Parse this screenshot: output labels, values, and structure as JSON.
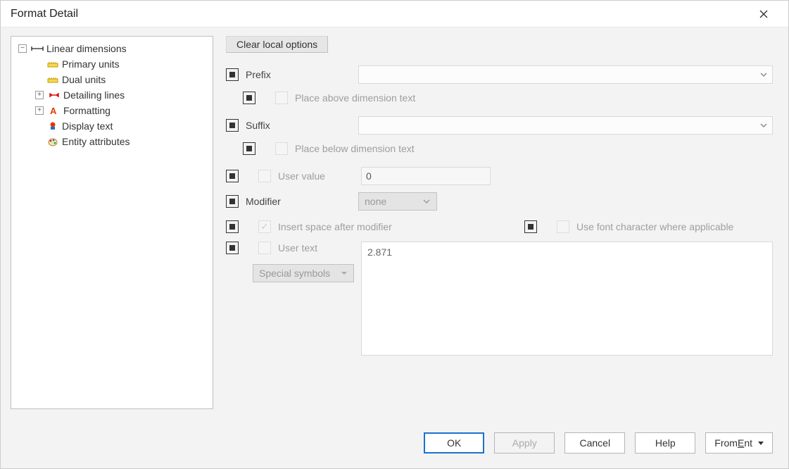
{
  "title": "Format Detail",
  "tree": {
    "root": "Linear dimensions",
    "primary": "Primary units",
    "dual": "Dual units",
    "detailing": "Detailing lines",
    "formatting": "Formatting",
    "display": "Display text",
    "entity": "Entity attributes"
  },
  "form": {
    "clear": "Clear local options",
    "prefix_label": "Prefix",
    "prefix_above": "Place above dimension text",
    "suffix_label": "Suffix",
    "suffix_below": "Place below dimension text",
    "user_value_label": "User value",
    "user_value": "0",
    "modifier_label": "Modifier",
    "modifier_value": "none",
    "insert_space": "Insert space after modifier",
    "use_font_char": "Use font character where applicable",
    "user_text_label": "User text",
    "user_text_value": "2.871",
    "special_symbols": "Special symbols"
  },
  "buttons": {
    "ok": "OK",
    "apply": "Apply",
    "cancel": "Cancel",
    "help": "Help",
    "from_ent_pre": "From ",
    "from_ent_under": "E",
    "from_ent_post": "nt"
  }
}
